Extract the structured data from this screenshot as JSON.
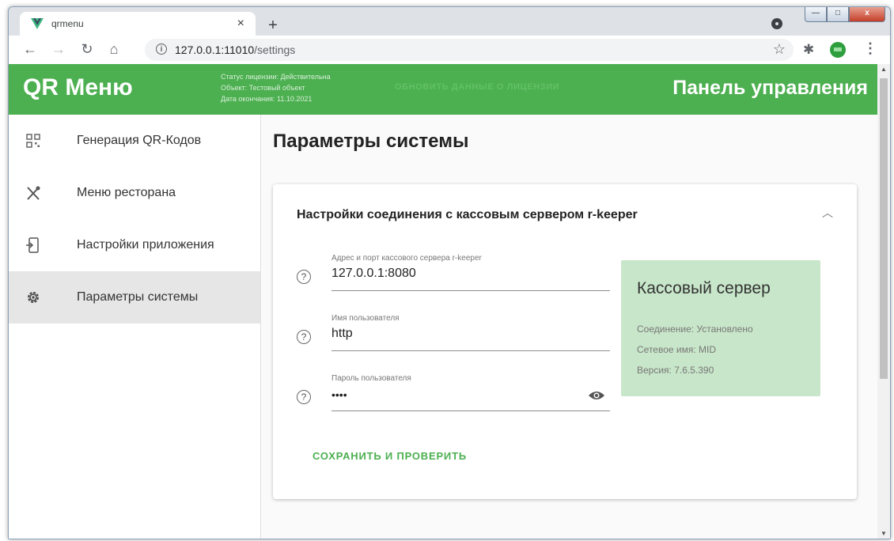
{
  "browser": {
    "tab_title": "qrmenu",
    "tab_close": "×",
    "new_tab": "+",
    "url_host": "127.0.0.1:11010",
    "url_path": "/settings",
    "win_min": "—",
    "win_max": "□",
    "win_close": "x"
  },
  "header": {
    "brand": "QR Меню",
    "license_status": "Статус лицензии: Действительна",
    "license_object": "Объект: Тестовый объект",
    "license_expiry": "Дата окончания: 11.10.2021",
    "refresh_link": "ОБНОВИТЬ ДАННЫЕ О ЛИЦЕНЗИИ",
    "panel_title": "Панель управления",
    "accent_color": "#4caf50"
  },
  "sidebar": {
    "items": [
      {
        "label": "Генерация QR-Кодов",
        "icon": "qr-code-icon"
      },
      {
        "label": "Меню ресторана",
        "icon": "utensils-icon"
      },
      {
        "label": "Настройки приложения",
        "icon": "app-settings-icon"
      },
      {
        "label": "Параметры системы",
        "icon": "gear-icon",
        "active": true
      }
    ]
  },
  "main": {
    "heading": "Параметры системы",
    "card": {
      "title": "Настройки соединения с кассовым сервером r-keeper",
      "fields": [
        {
          "label": "Адрес и порт кассового сервера r-keeper",
          "value": "127.0.0.1:8080"
        },
        {
          "label": "Имя пользователя",
          "value": "http"
        },
        {
          "label": "Пароль пользователя",
          "value": "••••"
        }
      ],
      "help_glyph": "?",
      "save_label": "СОХРАНИТЬ И ПРОВЕРИТЬ"
    },
    "server": {
      "title": "Кассовый сервер",
      "connection": "Соединение: Установлено",
      "network_name": "Сетевое имя: MID",
      "version": "Версия: 7.6.5.390",
      "panel_color": "#c8e6c9"
    }
  }
}
